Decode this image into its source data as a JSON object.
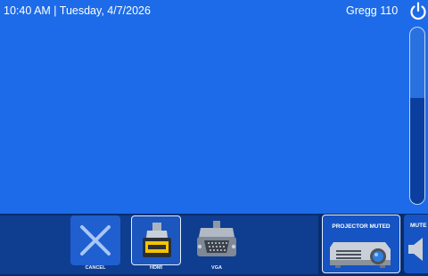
{
  "header": {
    "datetime": "10:40 AM  |  Tuesday, 4/7/2026",
    "room": "Gregg 110",
    "power_icon": "power-icon"
  },
  "volume": {
    "level": 0.6
  },
  "sources": [
    {
      "label": "CANCEL",
      "icon": "close-icon",
      "selected": false
    },
    {
      "label": "HDMI",
      "icon": "hdmi-connector-icon",
      "selected": true
    },
    {
      "label": "VGA",
      "icon": "vga-connector-icon",
      "selected": false
    }
  ],
  "projector": {
    "label": "PROJECTOR MUTED",
    "icon": "projector-icon"
  },
  "mute": {
    "label": "MUTE",
    "icon": "speaker-icon"
  },
  "colors": {
    "background": "#1d6be8",
    "bar": "#082d6f",
    "button": "#1554c2",
    "accent": "#f5c400"
  }
}
